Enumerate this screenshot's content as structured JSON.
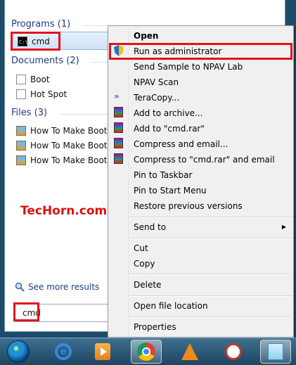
{
  "start_menu": {
    "programs": {
      "header": "Programs (1)",
      "items": [
        {
          "label": "cmd",
          "icon": "cmd-icon"
        }
      ]
    },
    "documents": {
      "header": "Documents (2)",
      "items": [
        {
          "label": "Boot",
          "icon": "document-icon"
        },
        {
          "label": "Hot Spot",
          "icon": "document-icon"
        }
      ]
    },
    "files": {
      "header": "Files (3)",
      "items": [
        {
          "label": "How To Make Boota",
          "icon": "image-file-icon"
        },
        {
          "label": "How To Make Boota",
          "icon": "image-file-icon"
        },
        {
          "label": "How To Make Boota",
          "icon": "image-file-icon"
        }
      ]
    },
    "see_more": "See more results",
    "search_value": "cmd",
    "watermark": "TecHorn.com"
  },
  "context_menu": {
    "items": [
      {
        "label": "Open",
        "bold": true
      },
      {
        "label": "Run as administrator",
        "icon": "uac-shield-icon"
      },
      {
        "label": "Send Sample to NPAV Lab"
      },
      {
        "label": "NPAV Scan"
      },
      {
        "label": "TeraCopy...",
        "icon": "teracopy-icon"
      },
      {
        "label": "Add to archive...",
        "icon": "winrar-icon"
      },
      {
        "label": "Add to \"cmd.rar\"",
        "icon": "winrar-icon"
      },
      {
        "label": "Compress and email...",
        "icon": "winrar-icon"
      },
      {
        "label": "Compress to \"cmd.rar\" and email",
        "icon": "winrar-icon"
      },
      {
        "label": "Pin to Taskbar"
      },
      {
        "label": "Pin to Start Menu"
      },
      {
        "label": "Restore previous versions"
      },
      {
        "label": "Send to",
        "submenu": true
      },
      {
        "label": "Cut"
      },
      {
        "label": "Copy"
      },
      {
        "label": "Delete"
      },
      {
        "label": "Open file location"
      },
      {
        "label": "Properties"
      }
    ]
  },
  "taskbar": {
    "buttons": [
      "start-orb-icon",
      "internet-explorer-icon",
      "media-player-icon",
      "chrome-icon",
      "vlc-icon",
      "snipping-tool-icon",
      "sticky-notes-icon"
    ]
  },
  "colors": {
    "highlight_border": "#e0141e",
    "header_text": "#1e3a8a",
    "watermark": "#e01010"
  }
}
